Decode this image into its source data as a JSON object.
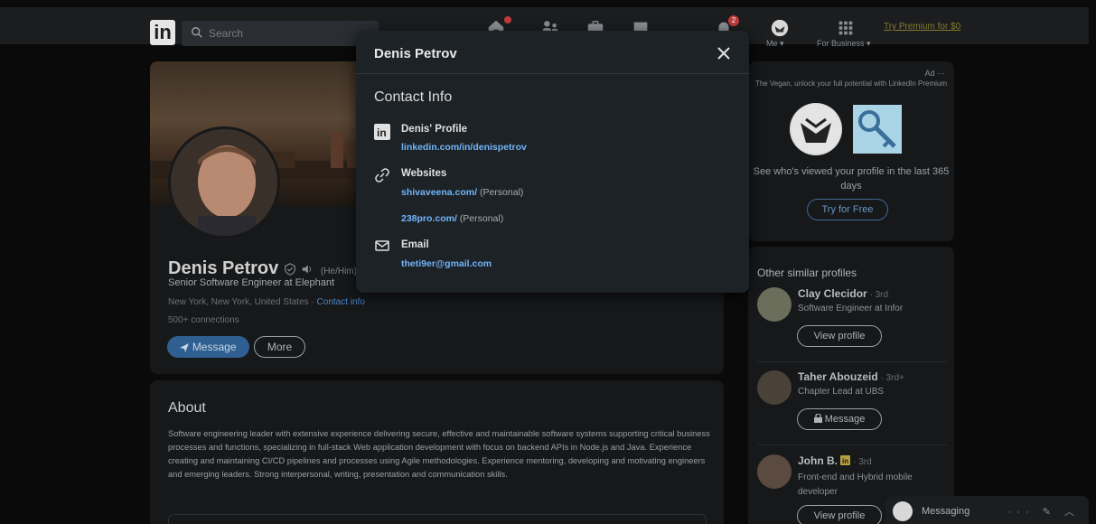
{
  "nav": {
    "search_placeholder": "Search",
    "me_label": "Me",
    "business_label": "For Business",
    "premium_link": "Try Premium for $0",
    "home_badge": "",
    "notif_badge": "2"
  },
  "profile": {
    "name": "Denis Petrov",
    "pronouns": "(He/Him)",
    "headline": "Senior Software Engineer at Elephant",
    "location": "New York, New York, United States · ",
    "contact_link": "Contact info",
    "connections": "500+ connections",
    "message_btn": "Message",
    "more_btn": "More"
  },
  "about": {
    "title": "About",
    "text": "Software engineering leader with extensive experience delivering secure, effective and maintainable software systems supporting critical business processes and functions, specializing in full-stack Web application development with focus on backend APIs in Node.js and Java. Experience creating and maintaining CI/CD pipelines and processes using Agile methodologies. Experience mentoring, developing and motivating engineers and emerging leaders. Strong interpersonal, writing, presentation and communication skills."
  },
  "ad": {
    "label": "Ad",
    "tagline": "The Vegan, unlock your full potential with LinkedIn Premium",
    "desc": "See who's viewed your profile in the last 365 days",
    "button": "Try for Free"
  },
  "similar": {
    "title": "Other similar profiles",
    "people": [
      {
        "name": "Clay Clecidor",
        "degree": " · 3rd",
        "headline": "Software Engineer at Infor",
        "button": "View profile"
      },
      {
        "name": "Taher Abouzeid",
        "degree": " · 3rd+",
        "headline": "Chapter Lead at UBS",
        "button": "Message"
      },
      {
        "name": "John B.",
        "degree": " · 3rd",
        "headline": "Front-end and Hybrid mobile developer",
        "button": "View profile"
      }
    ]
  },
  "messaging": {
    "label": "Messaging",
    "icons": "··· ✎ ︿"
  },
  "modal": {
    "title": "Denis Petrov",
    "section": "Contact Info",
    "profile_label": "Denis' Profile",
    "profile_url": "linkedin.com/in/denispetrov",
    "websites_label": "Websites",
    "site1": "shivaveena.com/",
    "site1_note": " (Personal)",
    "site2": "238pro.com/",
    "site2_note": " (Personal)",
    "email_label": "Email",
    "email": "theti9er@gmail.com"
  }
}
